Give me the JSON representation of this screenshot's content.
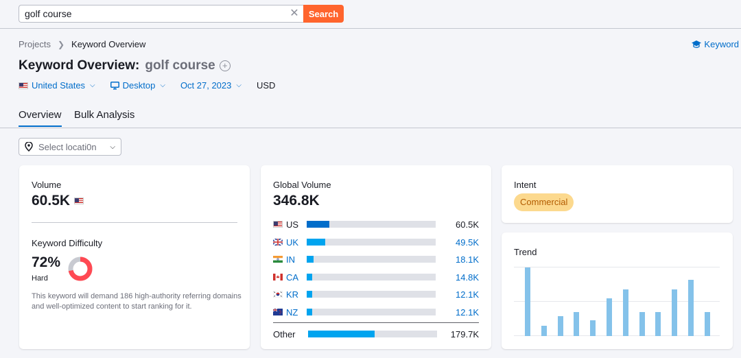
{
  "search": {
    "value": "golf course",
    "button_label": "Search"
  },
  "breadcrumb": {
    "root": "Projects",
    "current": "Keyword Overview"
  },
  "top_right_link": "Keyword",
  "title": {
    "prefix": "Keyword Overview:",
    "keyword": "golf course"
  },
  "filters": {
    "country": "United States",
    "device": "Desktop",
    "date": "Oct 27, 2023",
    "currency": "USD"
  },
  "tabs": [
    {
      "label": "Overview"
    },
    {
      "label": "Bulk Analysis"
    }
  ],
  "location_select": {
    "placeholder": "Select locati0n"
  },
  "volume_card": {
    "label": "Volume",
    "value": "60.5K",
    "kd_label": "Keyword Difficulty",
    "kd_value": "72%",
    "kd_percent": 72,
    "kd_level": "Hard",
    "kd_description": "This keyword will demand 186 high-authority referring domains and well-optimized content to start ranking for it."
  },
  "global_volume": {
    "label": "Global Volume",
    "value": "346.8K",
    "countries": [
      {
        "code": "US",
        "value": "60.5K",
        "share": 0.175,
        "color": "#006dca"
      },
      {
        "code": "UK",
        "value": "49.5K",
        "share": 0.143,
        "color": "#00a4ef"
      },
      {
        "code": "IN",
        "value": "18.1K",
        "share": 0.052,
        "color": "#00a4ef"
      },
      {
        "code": "CA",
        "value": "14.8K",
        "share": 0.043,
        "color": "#00a4ef"
      },
      {
        "code": "KR",
        "value": "12.1K",
        "share": 0.035,
        "color": "#00a4ef"
      },
      {
        "code": "NZ",
        "value": "12.1K",
        "share": 0.035,
        "color": "#00a4ef"
      }
    ],
    "other": {
      "label": "Other",
      "value": "179.7K",
      "share": 0.518,
      "color": "#00a4ef"
    }
  },
  "intent": {
    "label": "Intent",
    "badge": "Commercial"
  },
  "trend": {
    "label": "Trend",
    "values": [
      100,
      15,
      29,
      35,
      23,
      55,
      68,
      35,
      35,
      68,
      82,
      35
    ]
  }
}
